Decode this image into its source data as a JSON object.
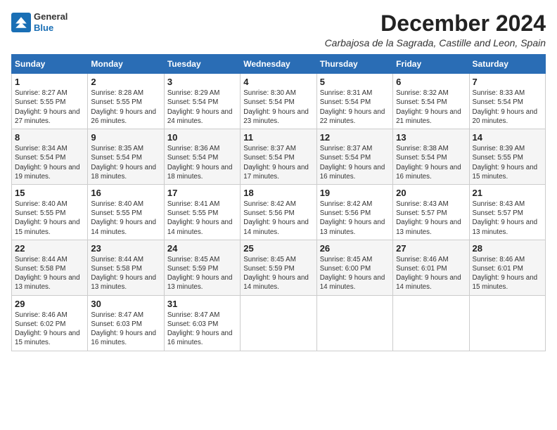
{
  "logo": {
    "line1": "General",
    "line2": "Blue"
  },
  "title": "December 2024",
  "location": "Carbajosa de la Sagrada, Castille and Leon, Spain",
  "days_of_week": [
    "Sunday",
    "Monday",
    "Tuesday",
    "Wednesday",
    "Thursday",
    "Friday",
    "Saturday"
  ],
  "weeks": [
    [
      {
        "day": "1",
        "details": "Sunrise: 8:27 AM\nSunset: 5:55 PM\nDaylight: 9 hours and 27 minutes."
      },
      {
        "day": "2",
        "details": "Sunrise: 8:28 AM\nSunset: 5:55 PM\nDaylight: 9 hours and 26 minutes."
      },
      {
        "day": "3",
        "details": "Sunrise: 8:29 AM\nSunset: 5:54 PM\nDaylight: 9 hours and 24 minutes."
      },
      {
        "day": "4",
        "details": "Sunrise: 8:30 AM\nSunset: 5:54 PM\nDaylight: 9 hours and 23 minutes."
      },
      {
        "day": "5",
        "details": "Sunrise: 8:31 AM\nSunset: 5:54 PM\nDaylight: 9 hours and 22 minutes."
      },
      {
        "day": "6",
        "details": "Sunrise: 8:32 AM\nSunset: 5:54 PM\nDaylight: 9 hours and 21 minutes."
      },
      {
        "day": "7",
        "details": "Sunrise: 8:33 AM\nSunset: 5:54 PM\nDaylight: 9 hours and 20 minutes."
      }
    ],
    [
      {
        "day": "8",
        "details": "Sunrise: 8:34 AM\nSunset: 5:54 PM\nDaylight: 9 hours and 19 minutes."
      },
      {
        "day": "9",
        "details": "Sunrise: 8:35 AM\nSunset: 5:54 PM\nDaylight: 9 hours and 18 minutes."
      },
      {
        "day": "10",
        "details": "Sunrise: 8:36 AM\nSunset: 5:54 PM\nDaylight: 9 hours and 18 minutes."
      },
      {
        "day": "11",
        "details": "Sunrise: 8:37 AM\nSunset: 5:54 PM\nDaylight: 9 hours and 17 minutes."
      },
      {
        "day": "12",
        "details": "Sunrise: 8:37 AM\nSunset: 5:54 PM\nDaylight: 9 hours and 16 minutes."
      },
      {
        "day": "13",
        "details": "Sunrise: 8:38 AM\nSunset: 5:54 PM\nDaylight: 9 hours and 16 minutes."
      },
      {
        "day": "14",
        "details": "Sunrise: 8:39 AM\nSunset: 5:55 PM\nDaylight: 9 hours and 15 minutes."
      }
    ],
    [
      {
        "day": "15",
        "details": "Sunrise: 8:40 AM\nSunset: 5:55 PM\nDaylight: 9 hours and 15 minutes."
      },
      {
        "day": "16",
        "details": "Sunrise: 8:40 AM\nSunset: 5:55 PM\nDaylight: 9 hours and 14 minutes."
      },
      {
        "day": "17",
        "details": "Sunrise: 8:41 AM\nSunset: 5:55 PM\nDaylight: 9 hours and 14 minutes."
      },
      {
        "day": "18",
        "details": "Sunrise: 8:42 AM\nSunset: 5:56 PM\nDaylight: 9 hours and 14 minutes."
      },
      {
        "day": "19",
        "details": "Sunrise: 8:42 AM\nSunset: 5:56 PM\nDaylight: 9 hours and 13 minutes."
      },
      {
        "day": "20",
        "details": "Sunrise: 8:43 AM\nSunset: 5:57 PM\nDaylight: 9 hours and 13 minutes."
      },
      {
        "day": "21",
        "details": "Sunrise: 8:43 AM\nSunset: 5:57 PM\nDaylight: 9 hours and 13 minutes."
      }
    ],
    [
      {
        "day": "22",
        "details": "Sunrise: 8:44 AM\nSunset: 5:58 PM\nDaylight: 9 hours and 13 minutes."
      },
      {
        "day": "23",
        "details": "Sunrise: 8:44 AM\nSunset: 5:58 PM\nDaylight: 9 hours and 13 minutes."
      },
      {
        "day": "24",
        "details": "Sunrise: 8:45 AM\nSunset: 5:59 PM\nDaylight: 9 hours and 13 minutes."
      },
      {
        "day": "25",
        "details": "Sunrise: 8:45 AM\nSunset: 5:59 PM\nDaylight: 9 hours and 14 minutes."
      },
      {
        "day": "26",
        "details": "Sunrise: 8:45 AM\nSunset: 6:00 PM\nDaylight: 9 hours and 14 minutes."
      },
      {
        "day": "27",
        "details": "Sunrise: 8:46 AM\nSunset: 6:01 PM\nDaylight: 9 hours and 14 minutes."
      },
      {
        "day": "28",
        "details": "Sunrise: 8:46 AM\nSunset: 6:01 PM\nDaylight: 9 hours and 15 minutes."
      }
    ],
    [
      {
        "day": "29",
        "details": "Sunrise: 8:46 AM\nSunset: 6:02 PM\nDaylight: 9 hours and 15 minutes."
      },
      {
        "day": "30",
        "details": "Sunrise: 8:47 AM\nSunset: 6:03 PM\nDaylight: 9 hours and 16 minutes."
      },
      {
        "day": "31",
        "details": "Sunrise: 8:47 AM\nSunset: 6:03 PM\nDaylight: 9 hours and 16 minutes."
      },
      null,
      null,
      null,
      null
    ]
  ]
}
